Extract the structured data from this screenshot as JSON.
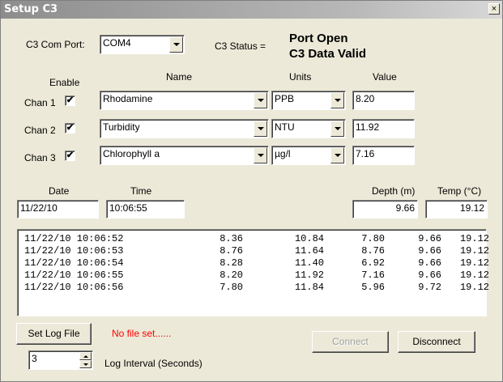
{
  "window": {
    "title": "Setup C3",
    "close_glyph": "×"
  },
  "com_port": {
    "label": "C3 Com Port:",
    "value": "COM4"
  },
  "status": {
    "label": "C3 Status =",
    "line1": "Port Open",
    "line2": "C3 Data Valid"
  },
  "headers": {
    "enable": "Enable",
    "name": "Name",
    "units": "Units",
    "value": "Value"
  },
  "channels": [
    {
      "label": "Chan 1",
      "enabled": true,
      "name": "Rhodamine",
      "units": "PPB",
      "value": "8.20"
    },
    {
      "label": "Chan 2",
      "enabled": true,
      "name": "Turbidity",
      "units": "NTU",
      "value": "11.92"
    },
    {
      "label": "Chan 3",
      "enabled": true,
      "name": "Chlorophyll a",
      "units": "µg/l",
      "value": "7.16"
    }
  ],
  "readings": {
    "date_label": "Date",
    "date": "11/22/10",
    "time_label": "Time",
    "time": "10:06:55",
    "depth_label": "Depth (m)",
    "depth": "9.66",
    "temp_label": "Temp (°C)",
    "temp": "19.12"
  },
  "log_rows": [
    [
      "11/22/10 10:06:52",
      "8.36",
      "10.84",
      "7.80",
      "9.66",
      "19.12"
    ],
    [
      "11/22/10 10:06:53",
      "8.76",
      "11.64",
      "8.76",
      "9.66",
      "19.12"
    ],
    [
      "11/22/10 10:06:54",
      "8.28",
      "11.40",
      "6.92",
      "9.66",
      "19.12"
    ],
    [
      "11/22/10 10:06:55",
      "8.20",
      "11.92",
      "7.16",
      "9.66",
      "19.12"
    ],
    [
      "11/22/10 10:06:56",
      "7.80",
      "11.84",
      "5.96",
      "9.72",
      "19.12"
    ]
  ],
  "log_file": {
    "button": "Set Log File",
    "status": "No file set......",
    "status_color": "#ff0000"
  },
  "log_interval": {
    "value": "3",
    "label": "Log Interval (Seconds)"
  },
  "buttons": {
    "connect": "Connect",
    "connect_enabled": false,
    "disconnect": "Disconnect"
  },
  "check_glyph": "✔"
}
